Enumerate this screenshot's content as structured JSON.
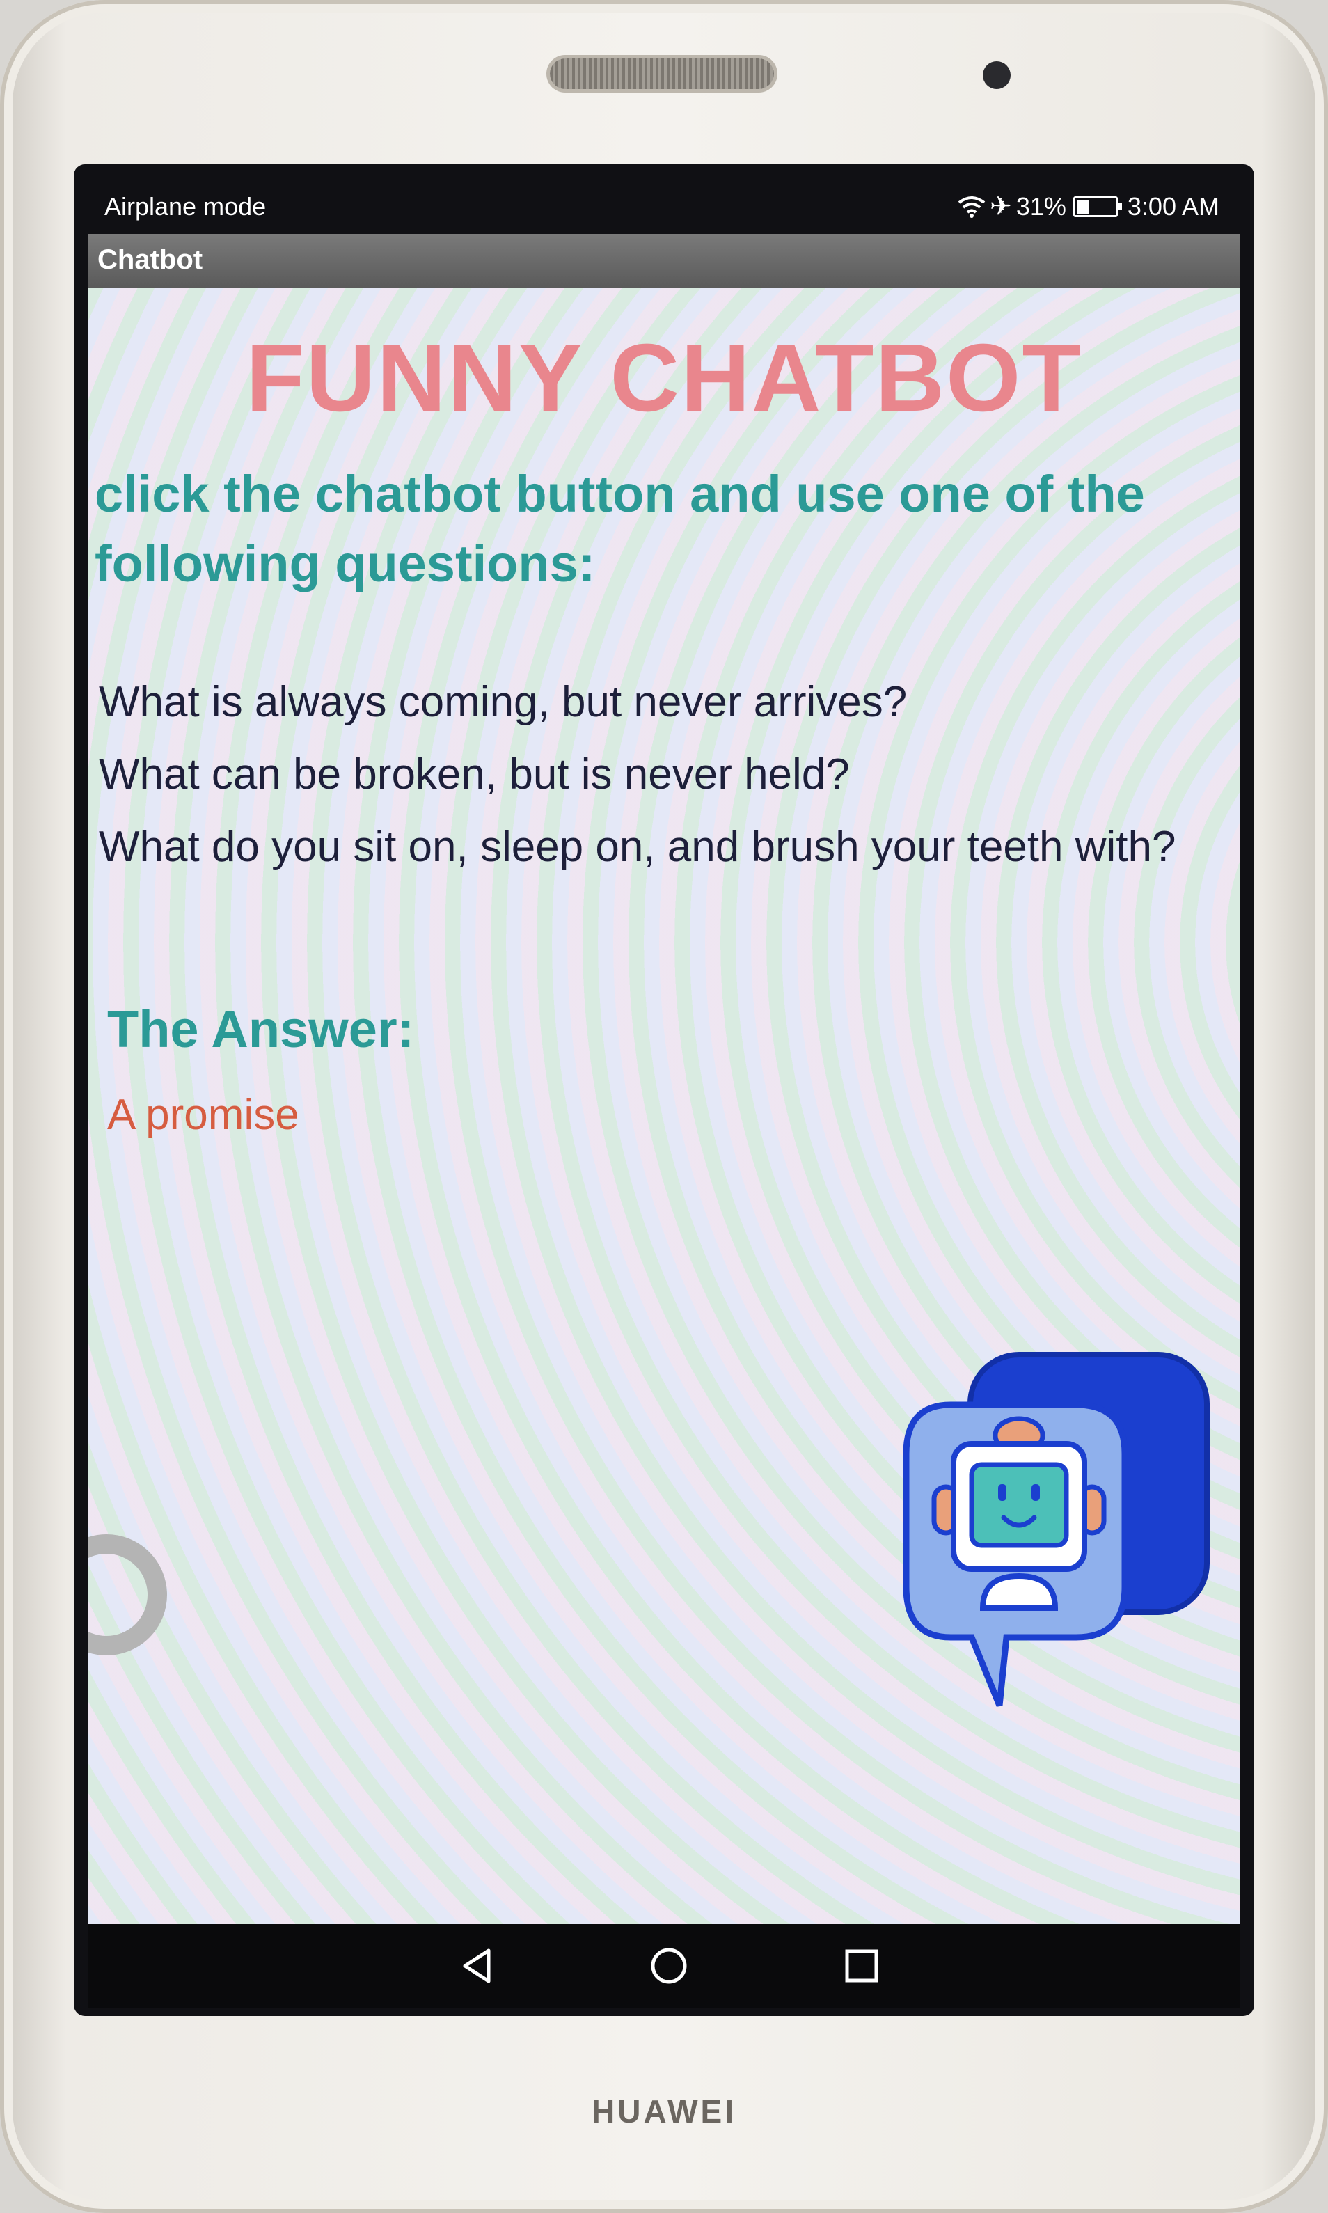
{
  "device": {
    "brand": "HUAWEI"
  },
  "status_bar": {
    "left_text": "Airplane mode",
    "battery_percent": "31%",
    "time": "3:00 AM",
    "icons": [
      "wifi-icon",
      "airplane-icon",
      "battery-icon"
    ]
  },
  "app_bar": {
    "title": "Chatbot"
  },
  "content": {
    "title": "FUNNY CHATBOT",
    "instruction": "click the chatbot button and use one of the following questions:",
    "questions": [
      "What is always coming, but never arrives?",
      "What can be broken, but is never held?",
      "What do you sit on, sleep on, and brush your teeth with?"
    ],
    "answer_label": "The Answer:",
    "answer_text": "A promise"
  },
  "chatbot_button": {
    "icon": "chatbot-robot-icon"
  },
  "nav_bar": {
    "buttons": [
      "back-icon",
      "home-icon",
      "recents-icon"
    ]
  },
  "colors": {
    "title": "#e9868d",
    "instruction": "#2b9a96",
    "question_text": "#1d1f3a",
    "answer_text": "#d65c40",
    "robot_blue": "#1b3fcf",
    "robot_light": "#8fb0ec"
  }
}
